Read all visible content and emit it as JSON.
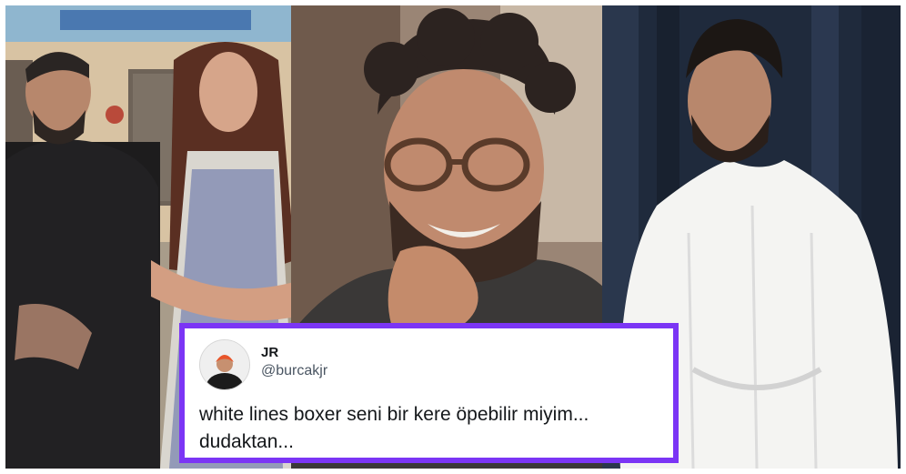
{
  "tweet": {
    "display_name": "JR",
    "handle": "@burcakjr",
    "text_line1": "white lines boxer seni bir kere öpebilir miyim...",
    "text_line2": "dudaktan..."
  },
  "colors": {
    "card_border": "#7b35f5",
    "background": "#ffffff"
  }
}
